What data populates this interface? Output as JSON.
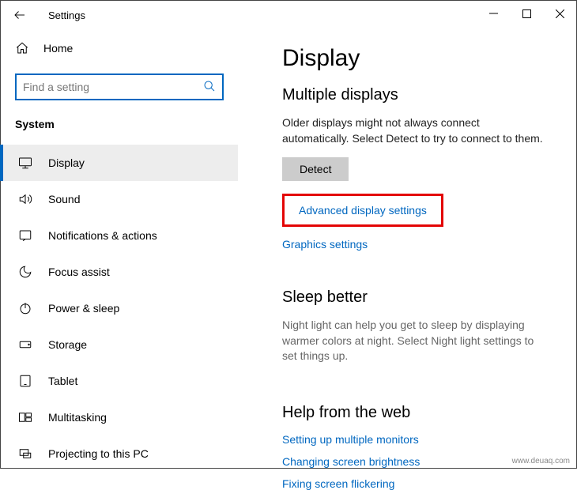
{
  "window": {
    "title": "Settings"
  },
  "sidebar": {
    "homeLabel": "Home",
    "searchPlaceholder": "Find a setting",
    "groupLabel": "System",
    "items": [
      {
        "label": "Display",
        "icon": "display-icon",
        "selected": true
      },
      {
        "label": "Sound",
        "icon": "sound-icon",
        "selected": false
      },
      {
        "label": "Notifications & actions",
        "icon": "notification-icon",
        "selected": false
      },
      {
        "label": "Focus assist",
        "icon": "focus-icon",
        "selected": false
      },
      {
        "label": "Power & sleep",
        "icon": "power-icon",
        "selected": false
      },
      {
        "label": "Storage",
        "icon": "storage-icon",
        "selected": false
      },
      {
        "label": "Tablet",
        "icon": "tablet-icon",
        "selected": false
      },
      {
        "label": "Multitasking",
        "icon": "multitask-icon",
        "selected": false
      },
      {
        "label": "Projecting to this PC",
        "icon": "project-icon",
        "selected": false
      }
    ]
  },
  "main": {
    "pageTitle": "Display",
    "multiple": {
      "heading": "Multiple displays",
      "description": "Older displays might not always connect automatically. Select Detect to try to connect to them.",
      "detectLabel": "Detect",
      "advancedLink": "Advanced display settings",
      "graphicsLink": "Graphics settings"
    },
    "sleep": {
      "heading": "Sleep better",
      "description": "Night light can help you get to sleep by displaying warmer colors at night. Select Night light settings to set things up."
    },
    "help": {
      "heading": "Help from the web",
      "links": [
        "Setting up multiple monitors",
        "Changing screen brightness",
        "Fixing screen flickering"
      ]
    }
  },
  "watermark": "www.deuaq.com"
}
